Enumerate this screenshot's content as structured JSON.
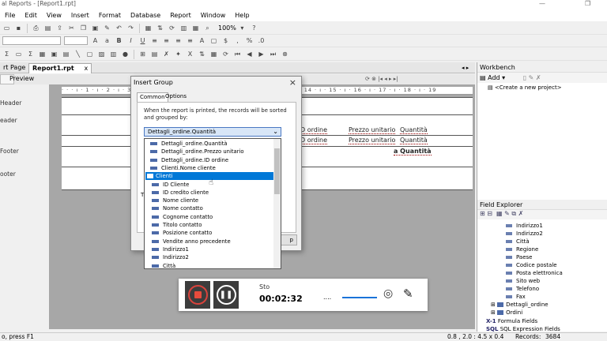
{
  "window": {
    "title": "al Reports - [Report1.rpt]"
  },
  "menu": [
    "File",
    "Edit",
    "View",
    "Insert",
    "Format",
    "Database",
    "Report",
    "Window",
    "Help"
  ],
  "toolbar": {
    "zoom": "100%"
  },
  "tabs": {
    "start_page": "rt Page",
    "report": "Report1.rpt",
    "close": "x",
    "preview": "Preview"
  },
  "sections": [
    "Header",
    "eader",
    "Footer",
    "ooter"
  ],
  "report_fields": {
    "hdr_id_ordine": "D ordine",
    "hdr_prezzo": "Prezzo unitario",
    "hdr_quantita": "Quantità",
    "det_id_ordine": "D ordine",
    "det_prezzo": "Prezzo unitario",
    "det_quantita": "Quantità",
    "sum_quantita": "a Quantità"
  },
  "workbench": {
    "title": "Workbench",
    "add": "Add",
    "create_project": "<Create a new project>"
  },
  "field_explorer": {
    "title": "Field Explorer",
    "fields": [
      "Indirizzo1",
      "Indirizzo2",
      "Città",
      "Regione",
      "Paese",
      "Codice postale",
      "Posta elettronica",
      "Sito web",
      "Telefono",
      "Fax"
    ],
    "tables": [
      "Dettagli_ordine",
      "Ordini"
    ],
    "formula_fields": "Formula Fields",
    "sql_fields": "SQL Expression Fields"
  },
  "status": {
    "help": "o, press F1",
    "dimensions": "0.8 , 2.0 : 4.5 x 0.4",
    "records_label": "Records:",
    "records": "3684"
  },
  "dialog": {
    "title": "Insert Group",
    "close": "×",
    "tab_common": "Common",
    "tab_options": "Options",
    "description": "When the report is printed, the records will be sorted and grouped by:",
    "selected": "Dettagli_ordine.Quantità",
    "ok_partial": "p",
    "side_note": "T"
  },
  "dropdown": {
    "items": [
      {
        "label": "Dettagli_ordine.Quantità",
        "kind": "field"
      },
      {
        "label": "Dettagli_ordine.Prezzo unitario",
        "kind": "field"
      },
      {
        "label": "Dettagli_ordine.ID ordine",
        "kind": "field"
      },
      {
        "label": "Clienti.Nome cliente",
        "kind": "field"
      },
      {
        "label": "Clienti",
        "kind": "table"
      },
      {
        "label": "ID Cliente",
        "kind": "child"
      },
      {
        "label": "ID credito cliente",
        "kind": "child"
      },
      {
        "label": "Nome cliente",
        "kind": "child"
      },
      {
        "label": "Nome contatto",
        "kind": "child"
      },
      {
        "label": "Cognome contatto",
        "kind": "child"
      },
      {
        "label": "Titolo contatto",
        "kind": "child"
      },
      {
        "label": "Posizione contatto",
        "kind": "child"
      },
      {
        "label": "Vendite anno precedente",
        "kind": "child"
      },
      {
        "label": "Indirizzo1",
        "kind": "child"
      },
      {
        "label": "Indirizzo2",
        "kind": "child"
      },
      {
        "label": "Città",
        "kind": "child"
      }
    ],
    "selected_index": 4
  },
  "recorder": {
    "status": "Sto",
    "time": "00:02:32",
    "dots": "...."
  },
  "colors": {
    "accent": "#0078d7",
    "record_red": "#e64b3c"
  }
}
